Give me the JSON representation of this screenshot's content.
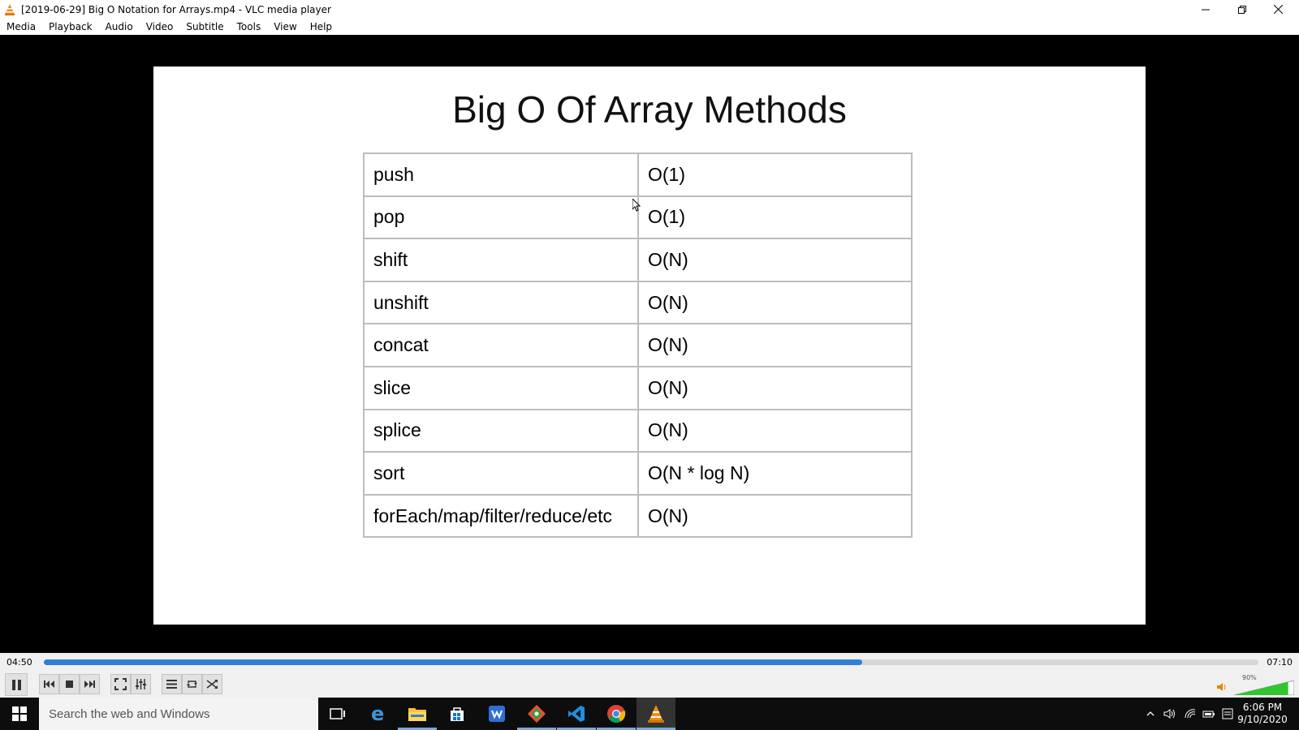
{
  "window": {
    "title": "[2019-06-29] Big O Notation for Arrays.mp4 - VLC media player"
  },
  "menu": [
    "Media",
    "Playback",
    "Audio",
    "Video",
    "Subtitle",
    "Tools",
    "View",
    "Help"
  ],
  "slide": {
    "title": "Big O Of Array Methods",
    "rows": [
      {
        "method": "push",
        "complexity": "O(1)"
      },
      {
        "method": "pop",
        "complexity": "O(1)"
      },
      {
        "method": "shift",
        "complexity": "O(N)"
      },
      {
        "method": "unshift",
        "complexity": "O(N)"
      },
      {
        "method": "concat",
        "complexity": "O(N)"
      },
      {
        "method": "slice",
        "complexity": "O(N)"
      },
      {
        "method": "splice",
        "complexity": "O(N)"
      },
      {
        "method": "sort",
        "complexity": "O(N * log N)"
      },
      {
        "method": "forEach/map/filter/reduce/etc",
        "complexity": "O(N)"
      }
    ]
  },
  "player": {
    "time_elapsed": "04:50",
    "time_total": "07:10",
    "progress": 0.674,
    "volume_label": "90%",
    "volume_level": 0.9,
    "accent_color": "#2f7fd8"
  },
  "taskbar": {
    "search_placeholder": "Search the web and Windows",
    "apps": [
      "task-view-icon",
      "edge-icon",
      "file-explorer-icon",
      "store-icon",
      "wps-icon",
      "git-icon",
      "vscode-icon",
      "chrome-icon",
      "vlc-icon"
    ],
    "clock_time": "6:06 PM",
    "clock_date": "9/10/2020"
  }
}
